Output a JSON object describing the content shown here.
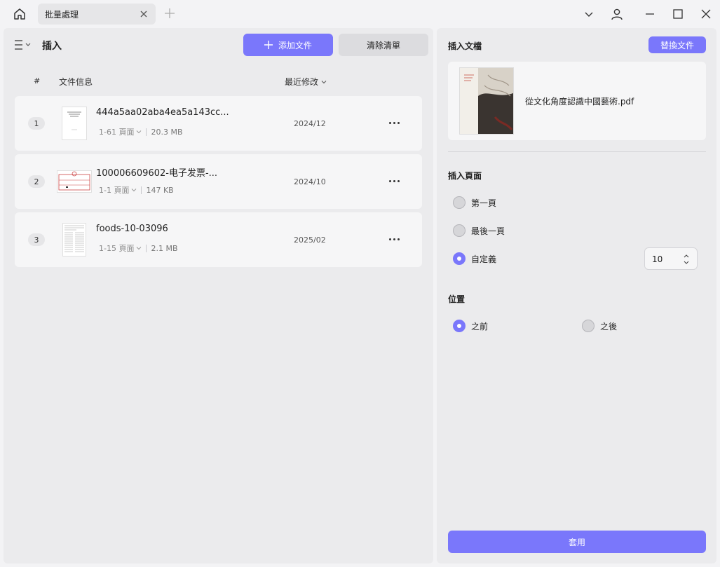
{
  "titlebar": {
    "tab_title": "批量處理"
  },
  "left": {
    "title": "插入",
    "add_file_label": "添加文件",
    "clear_list_label": "清除清單",
    "columns": {
      "hash": "#",
      "file_info": "文件信息",
      "recent_modified": "最近修改"
    },
    "files": [
      {
        "num": "1",
        "name": "444a5aa02aba4ea5a143cc...",
        "pages": "1-61 頁面",
        "size": "20.3 MB",
        "date": "2024/12"
      },
      {
        "num": "2",
        "name": "100006609602-电子发票-...",
        "pages": "1-1 頁面",
        "size": "147 KB",
        "date": "2024/10"
      },
      {
        "num": "3",
        "name": "foods-10-03096",
        "pages": "1-15 頁面",
        "size": "2.1 MB",
        "date": "2025/02"
      }
    ]
  },
  "right": {
    "insert_doc_title": "插入文檔",
    "replace_label": "替換文件",
    "doc_name": "從文化角度認識中國藝術.pdf",
    "insert_page_title": "插入頁面",
    "options": {
      "first": "第一頁",
      "last": "最後一頁",
      "custom": "自定義"
    },
    "custom_value": "10",
    "position_title": "位置",
    "position": {
      "before": "之前",
      "after": "之後"
    },
    "apply_label": "套用"
  },
  "colors": {
    "accent": "#7a77fb",
    "panel_bg": "#ebebed",
    "card_bg": "#f6f6f7"
  }
}
